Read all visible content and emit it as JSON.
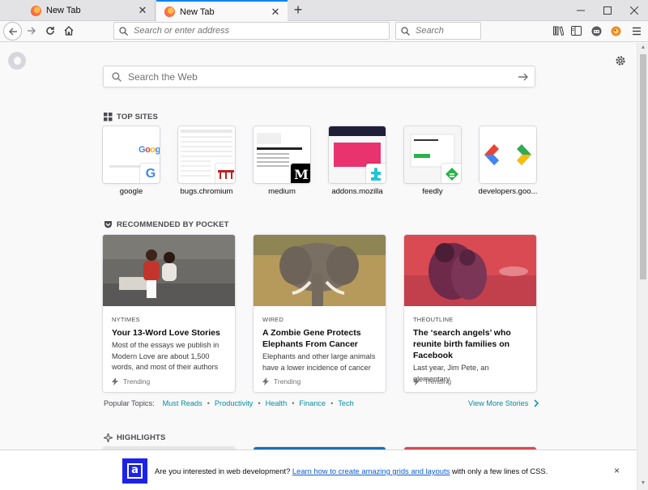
{
  "browser": {
    "tabs": [
      {
        "title": "New Tab",
        "active": false
      },
      {
        "title": "New Tab",
        "active": true
      }
    ],
    "new_tab_symbol": "+",
    "window_controls": {
      "minimize": "—",
      "maximize": "☐",
      "close": "✕"
    },
    "urlbar_placeholder": "Search or enter address",
    "searchbar_placeholder": "Search",
    "toolbar_icons": [
      "library-icon",
      "sidebar-icon",
      "extension-icon",
      "extension-2-icon",
      "menu-icon"
    ]
  },
  "newtab": {
    "web_search_placeholder": "Search the Web",
    "top_sites_title": "TOP SITES",
    "top_sites": [
      {
        "label": "google"
      },
      {
        "label": "bugs.chromium"
      },
      {
        "label": "medium"
      },
      {
        "label": "addons.mozilla"
      },
      {
        "label": "feedly"
      },
      {
        "label": "developers.goo..."
      }
    ],
    "pocket_title": "RECOMMENDED BY POCKET",
    "stories": [
      {
        "source": "NYTIMES",
        "title": "Your 13-Word Love Stories",
        "excerpt": "Most of the essays we publish in Modern Love are about 1,500 words, and most of their authors",
        "context": "Trending"
      },
      {
        "source": "WIRED",
        "title": "A Zombie Gene Protects Elephants From Cancer",
        "excerpt": "Elephants and other large animals have a lower incidence of cancer",
        "context": "Trending"
      },
      {
        "source": "THEOUTLINE",
        "title": "The ‘search angels’ who reunite birth families on Facebook",
        "excerpt": "Last year, Jim Pete, an elementary",
        "context": "Trending"
      }
    ],
    "popular_topics_label": "Popular Topics:",
    "topics": [
      "Must Reads",
      "Productivity",
      "Health",
      "Finance",
      "Tech"
    ],
    "view_more": "View More Stories",
    "highlights_title": "HIGHLIGHTS"
  },
  "notification": {
    "text_before": "Are you interested in web development?",
    "link_text": "Learn how to create amazing grids and layouts",
    "text_after": "with only a few lines of CSS.",
    "logo_letter": "a",
    "close": "×"
  },
  "colors": {
    "accent": "#0a84ff",
    "link_teal": "#008ea4",
    "notify_logo": "#1d22ea"
  }
}
